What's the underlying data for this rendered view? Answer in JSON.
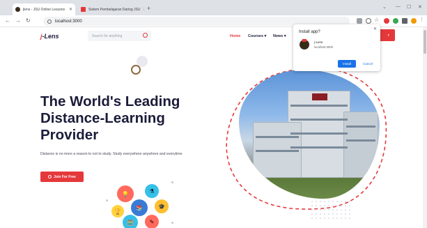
{
  "browser": {
    "tabs": [
      {
        "title": "jlens - JSU Online Lessons",
        "active": true
      },
      {
        "title": "Sistem Pembelajaran Daring JSU",
        "active": false
      }
    ],
    "url": "localhost:3000"
  },
  "site": {
    "logo": {
      "mark": "j",
      "text": "-Lens"
    },
    "search_placeholder": "Search for anything",
    "nav": [
      {
        "label": "Home",
        "active": true
      },
      {
        "label": "Courses ▾",
        "active": false
      },
      {
        "label": "News ▾",
        "active": false
      }
    ],
    "cta_fragment": "r"
  },
  "hero": {
    "title": "The World's Leading Distance-Learning Provider",
    "subtitle": "Distance is no more a reason to not to study. Study everywhere anywhere and everytime",
    "join_label": "Join For Free"
  },
  "install_popup": {
    "title": "Install app?",
    "app_name": "j-Lens",
    "app_url": "localhost:3000",
    "install_label": "Install",
    "cancel_label": "Cancel"
  },
  "colors": {
    "accent": "#e5383b",
    "navy": "#1b1b3a",
    "chrome_blue": "#1a73e8"
  }
}
